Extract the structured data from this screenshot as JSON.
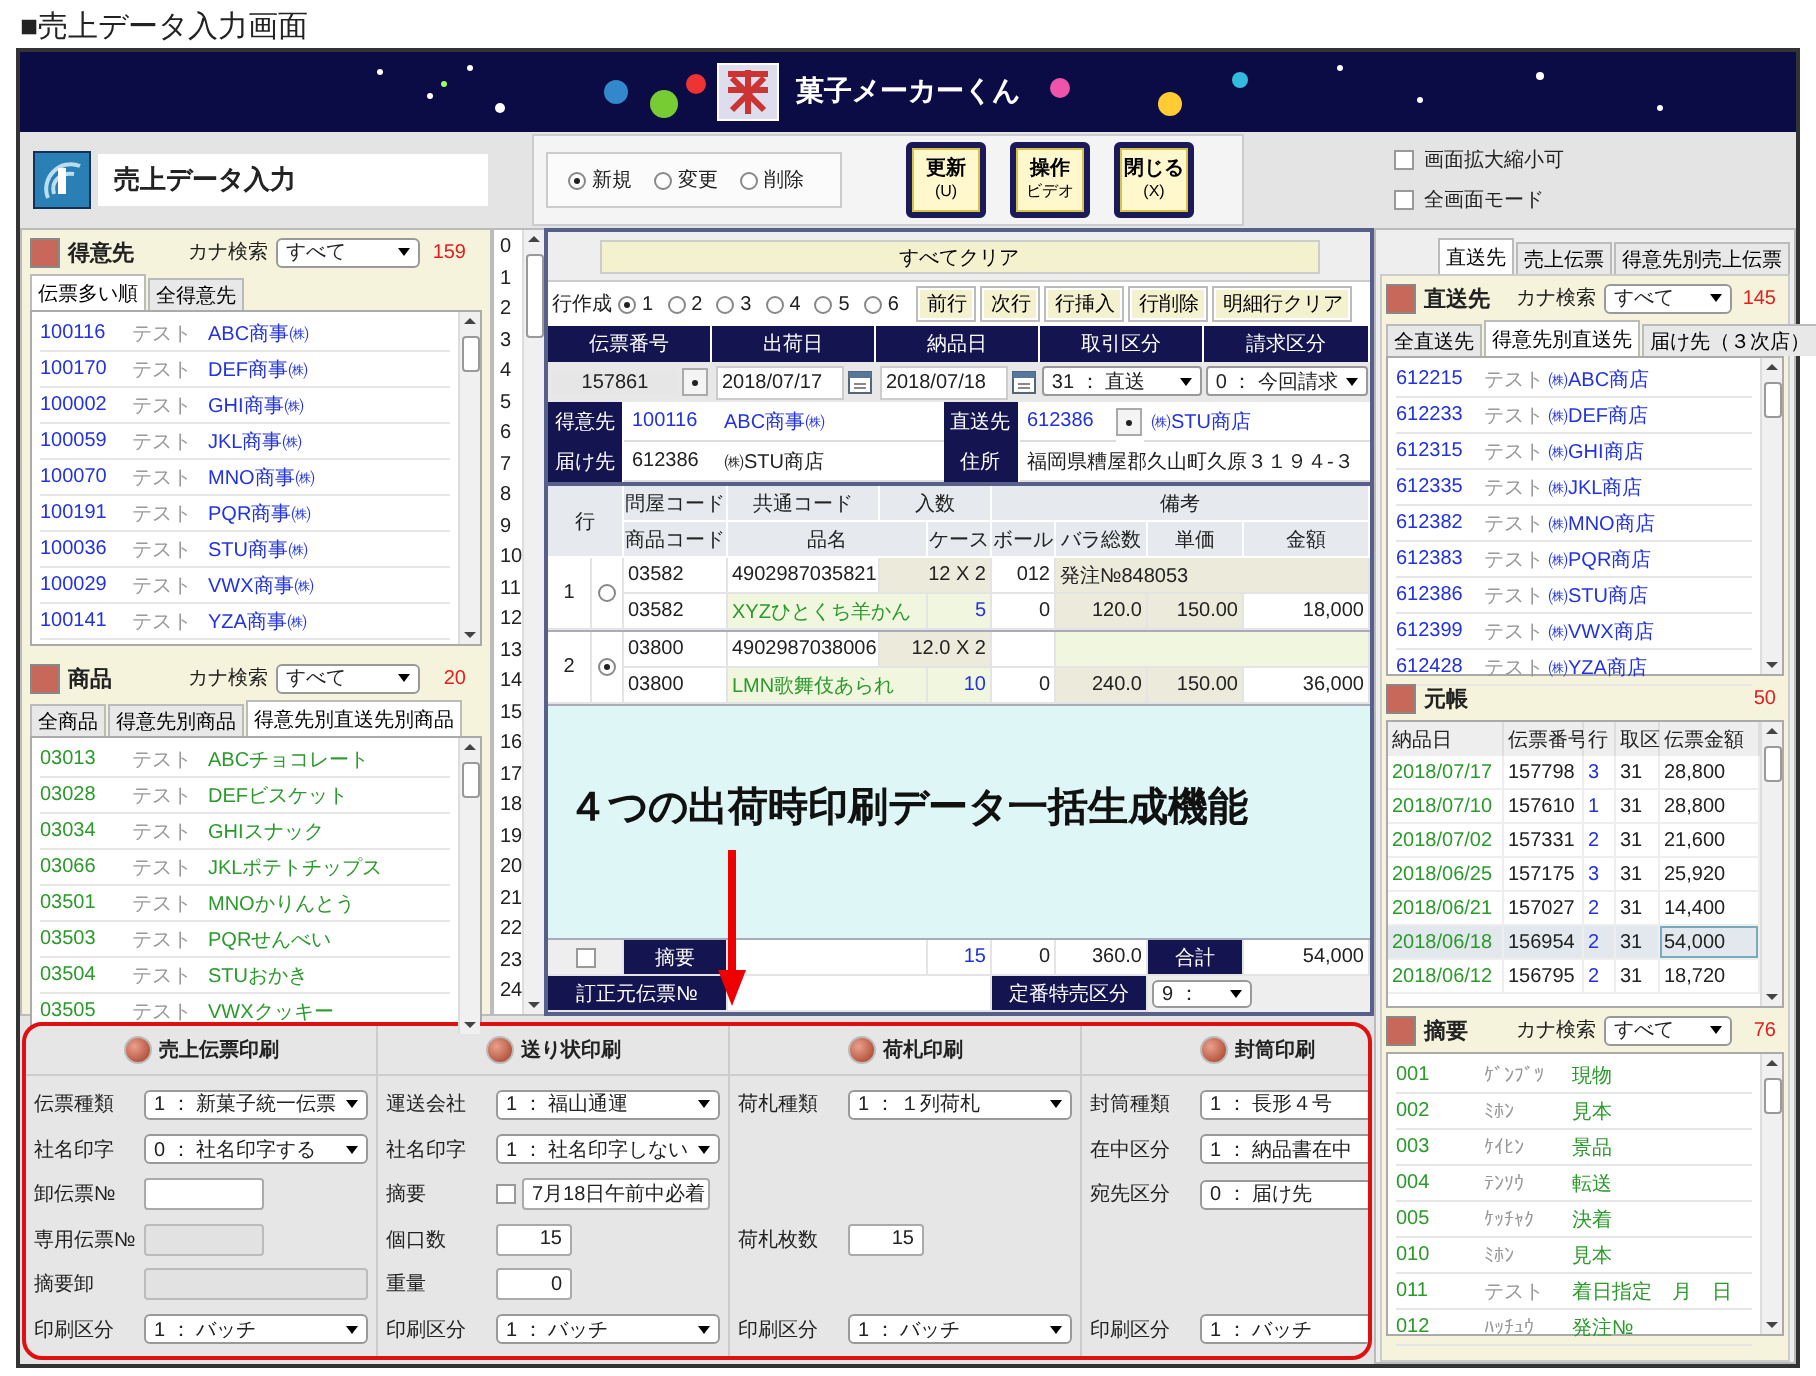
{
  "caption": "■売上データ入力画面",
  "banner": {
    "title": "菓子メーカーくん"
  },
  "screen_title": "売上データ入力",
  "mode_options": [
    {
      "label": "新規",
      "selected": true
    },
    {
      "label": "変更",
      "selected": false
    },
    {
      "label": "削除",
      "selected": false
    }
  ],
  "toolbar_buttons": [
    {
      "label": "更新",
      "sub": "(U)"
    },
    {
      "label": "操作",
      "sub": "ビデオ"
    },
    {
      "label": "閉じる",
      "sub": "(X)"
    }
  ],
  "options": [
    {
      "label": "画面拡大縮小可",
      "checked": false
    },
    {
      "label": "全画面モード",
      "checked": false
    }
  ],
  "customers": {
    "title": "得意先",
    "search_label": "カナ検索",
    "search_value": "すべて",
    "count": "159",
    "tabs": [
      {
        "label": "伝票多い順",
        "selected": true
      },
      {
        "label": "全得意先",
        "selected": false
      }
    ],
    "rows": [
      {
        "code": "100116",
        "kana": "テスト",
        "name": "ABC商事㈱"
      },
      {
        "code": "100170",
        "kana": "テスト",
        "name": "DEF商事㈱"
      },
      {
        "code": "100002",
        "kana": "テスト",
        "name": "GHI商事㈱"
      },
      {
        "code": "100059",
        "kana": "テスト",
        "name": "JKL商事㈱"
      },
      {
        "code": "100070",
        "kana": "テスト",
        "name": "MNO商事㈱"
      },
      {
        "code": "100191",
        "kana": "テスト",
        "name": "PQR商事㈱"
      },
      {
        "code": "100036",
        "kana": "テスト",
        "name": "STU商事㈱"
      },
      {
        "code": "100029",
        "kana": "テスト",
        "name": "VWX商事㈱"
      },
      {
        "code": "100141",
        "kana": "テスト",
        "name": "YZA商事㈱"
      }
    ]
  },
  "products": {
    "title": "商品",
    "search_label": "カナ検索",
    "search_value": "すべて",
    "count": "20",
    "tabs": [
      {
        "label": "全商品",
        "selected": false
      },
      {
        "label": "得意先別商品",
        "selected": false
      },
      {
        "label": "得意先別直送先別商品",
        "selected": true
      }
    ],
    "rows": [
      {
        "code": "03013",
        "kana": "テスト",
        "name": "ABCチョコレート"
      },
      {
        "code": "03028",
        "kana": "テスト",
        "name": "DEFビスケット"
      },
      {
        "code": "03034",
        "kana": "テスト",
        "name": "GHIスナック"
      },
      {
        "code": "03066",
        "kana": "テスト",
        "name": "JKLポテトチップス"
      },
      {
        "code": "03501",
        "kana": "テスト",
        "name": "MNOかりんとう"
      },
      {
        "code": "03503",
        "kana": "テスト",
        "name": "PQRせんべい"
      },
      {
        "code": "03504",
        "kana": "テスト",
        "name": "STUおかき"
      },
      {
        "code": "03505",
        "kana": "テスト",
        "name": "VWXクッキー"
      }
    ]
  },
  "line_numbers": [
    "0",
    "1",
    "2",
    "3",
    "4",
    "5",
    "6",
    "7",
    "8",
    "9",
    "10",
    "11",
    "12",
    "13",
    "14",
    "15",
    "16",
    "17",
    "18",
    "19",
    "20",
    "21",
    "22",
    "23",
    "24"
  ],
  "entry": {
    "clear_button": "すべてクリア",
    "line_label": "行作成",
    "line_options": [
      {
        "label": "1",
        "selected": true
      },
      {
        "label": "2",
        "selected": false
      },
      {
        "label": "3",
        "selected": false
      },
      {
        "label": "4",
        "selected": false
      },
      {
        "label": "5",
        "selected": false
      },
      {
        "label": "6",
        "selected": false
      }
    ],
    "nav_buttons": [
      "前行",
      "次行",
      "行挿入",
      "行削除",
      "明細行クリア"
    ],
    "header_columns": [
      "伝票番号",
      "出荷日",
      "納品日",
      "取引区分",
      "請求区分"
    ],
    "slip_number": "157861",
    "ship_date": "2018/07/17",
    "delivery_date": "2018/07/18",
    "trade_type": "31 ： 直送",
    "billing_type": "0 ： 今回請求",
    "customer": {
      "label": "得意先",
      "code": "100116",
      "name": "ABC商事㈱"
    },
    "direct": {
      "label": "直送先",
      "code": "612386",
      "name": "㈱STU商店"
    },
    "deliver": {
      "label": "届け先",
      "code": "612386",
      "name": "㈱STU商店"
    },
    "address": {
      "label": "住所",
      "value": "福岡県糟屋郡久山町久原３１９４-３"
    },
    "table_header_1": [
      "行",
      "問屋コード",
      "共通コード",
      "入数",
      "備考"
    ],
    "table_header_2": [
      "商品コード",
      "品名",
      "ケース",
      "ボール",
      "バラ総数",
      "単価",
      "金額"
    ],
    "items": [
      {
        "no": "1",
        "selected": false,
        "wholesale_code": "03582",
        "jan": "4902987035821",
        "pack": "12 X 2",
        "ball_count": "012",
        "remark": "発注№848053",
        "product_code": "03582",
        "name": "XYZひとくち羊かん",
        "cases": "5",
        "balls": "0",
        "pieces": "120.0",
        "unit_price": "150.00",
        "amount": "18,000"
      },
      {
        "no": "2",
        "selected": true,
        "wholesale_code": "03800",
        "jan": "4902987038006",
        "pack": "12.0 X 2",
        "product_code": "03800",
        "name": "LMN歌舞伎あられ",
        "cases": "10",
        "balls": "0",
        "pieces": "240.0",
        "unit_price": "150.00",
        "amount": "36,000"
      }
    ],
    "memo_checked": false,
    "memo_label": "摘要",
    "total_cases": "15",
    "total_balls": "0",
    "total_pieces": "360.0",
    "total_label": "合計",
    "total_amount": "54,000",
    "correction_label": "訂正元伝票№",
    "special_label": "定番特売区分",
    "special_value": "9 ："
  },
  "annotation": "４つの出荷時印刷データ一括生成機能",
  "print_panels": [
    {
      "title": "売上伝票印刷",
      "fields": [
        {
          "kind": "select",
          "label": "伝票種類",
          "value": "1 ： 新菓子統一伝票"
        },
        {
          "kind": "select",
          "label": "社名印字",
          "value": "0 ： 社名印字する"
        },
        {
          "kind": "text",
          "label": "卸伝票№",
          "disabled": false
        },
        {
          "kind": "text",
          "label": "専用伝票№",
          "disabled": true
        },
        {
          "kind": "long_text",
          "label": "摘要卸",
          "disabled": true
        },
        {
          "kind": "select",
          "label": "印刷区分",
          "value": "1 ： バッチ"
        }
      ]
    },
    {
      "title": "送り状印刷",
      "fields": [
        {
          "kind": "select",
          "label": "運送会社",
          "value": "1 ： 福山通運"
        },
        {
          "kind": "select",
          "label": "社名印字",
          "value": "1 ： 社名印字しない"
        },
        {
          "kind": "memo",
          "label": "摘要",
          "checked": false,
          "value": "7月18日午前中必着"
        },
        {
          "kind": "number",
          "label": "個口数",
          "value": "15"
        },
        {
          "kind": "number",
          "label": "重量",
          "value": "0"
        },
        {
          "kind": "select",
          "label": "印刷区分",
          "value": "1 ： バッチ"
        }
      ]
    },
    {
      "title": "荷札印刷",
      "fields": [
        {
          "kind": "select",
          "label": "荷札種類",
          "value": "1 ： １列荷札"
        },
        {
          "kind": "empty"
        },
        {
          "kind": "empty"
        },
        {
          "kind": "number",
          "label": "荷札枚数",
          "value": "15"
        },
        {
          "kind": "empty"
        },
        {
          "kind": "select",
          "label": "印刷区分",
          "value": "1 ： バッチ"
        }
      ]
    },
    {
      "title": "封筒印刷",
      "fields": [
        {
          "kind": "select",
          "label": "封筒種類",
          "value": "1 ： 長形４号"
        },
        {
          "kind": "select",
          "label": "在中区分",
          "value": "1 ： 納品書在中"
        },
        {
          "kind": "select",
          "label": "宛先区分",
          "value": "0 ： 届け先"
        },
        {
          "kind": "empty"
        },
        {
          "kind": "empty"
        },
        {
          "kind": "select",
          "label": "印刷区分",
          "value": "1 ： バッチ"
        }
      ]
    }
  ],
  "right_tabs": [
    {
      "label": "直送先",
      "selected": true
    },
    {
      "label": "売上伝票",
      "selected": false
    },
    {
      "label": "得意先別売上伝票",
      "selected": false
    }
  ],
  "direct_list": {
    "title": "直送先",
    "search_label": "カナ検索",
    "search_value": "すべて",
    "count": "145",
    "tabs": [
      {
        "label": "全直送先",
        "selected": false
      },
      {
        "label": "得意先別直送先",
        "selected": true
      },
      {
        "label": "届け先（３次店）",
        "selected": false
      }
    ],
    "rows": [
      {
        "code": "612215",
        "kana": "テスト",
        "name": "㈱ABC商店"
      },
      {
        "code": "612233",
        "kana": "テスト",
        "name": "㈱DEF商店"
      },
      {
        "code": "612315",
        "kana": "テスト",
        "name": "㈱GHI商店"
      },
      {
        "code": "612335",
        "kana": "テスト",
        "name": "㈱JKL商店"
      },
      {
        "code": "612382",
        "kana": "テスト",
        "name": "㈱MNO商店"
      },
      {
        "code": "612383",
        "kana": "テスト",
        "name": "㈱PQR商店"
      },
      {
        "code": "612386",
        "kana": "テスト",
        "name": "㈱STU商店"
      },
      {
        "code": "612399",
        "kana": "テスト",
        "name": "㈱VWX商店"
      },
      {
        "code": "612428",
        "kana": "テスト",
        "name": "㈱YZA商店"
      }
    ]
  },
  "ledger": {
    "title": "元帳",
    "count": "50",
    "columns": [
      "納品日",
      "伝票番号",
      "行",
      "取区",
      "伝票金額"
    ],
    "rows": [
      {
        "date": "2018/07/17",
        "slip": "157798",
        "line": "3",
        "type": "31",
        "amount": "28,800",
        "selected": false
      },
      {
        "date": "2018/07/10",
        "slip": "157610",
        "line": "1",
        "type": "31",
        "amount": "28,800",
        "selected": false
      },
      {
        "date": "2018/07/02",
        "slip": "157331",
        "line": "2",
        "type": "31",
        "amount": "21,600",
        "selected": false
      },
      {
        "date": "2018/06/25",
        "slip": "157175",
        "line": "3",
        "type": "31",
        "amount": "25,920",
        "selected": false
      },
      {
        "date": "2018/06/21",
        "slip": "157027",
        "line": "2",
        "type": "31",
        "amount": "14,400",
        "selected": false
      },
      {
        "date": "2018/06/18",
        "slip": "156954",
        "line": "2",
        "type": "31",
        "amount": "54,000",
        "selected": true
      },
      {
        "date": "2018/06/12",
        "slip": "156795",
        "line": "2",
        "type": "31",
        "amount": "18,720",
        "selected": false
      }
    ]
  },
  "remarks": {
    "title": "摘要",
    "search_label": "カナ検索",
    "search_value": "すべて",
    "count": "76",
    "rows": [
      {
        "code": "001",
        "kana": "ｹﾞﾝﾌﾞﾂ",
        "name": "現物"
      },
      {
        "code": "002",
        "kana": "ﾐﾎﾝ",
        "name": "見本"
      },
      {
        "code": "003",
        "kana": "ｹｲﾋﾝ",
        "name": "景品"
      },
      {
        "code": "004",
        "kana": "ﾃﾝｿｳ",
        "name": "転送"
      },
      {
        "code": "005",
        "kana": "ｹｯﾁｬｸ",
        "name": "決着"
      },
      {
        "code": "010",
        "kana": "ﾐﾎﾝ",
        "name": "見本"
      },
      {
        "code": "011",
        "kana": "テスト",
        "name": "着日指定　月　日"
      },
      {
        "code": "012",
        "kana": "ﾊｯﾁｭｳ",
        "name": "発注№"
      }
    ]
  }
}
